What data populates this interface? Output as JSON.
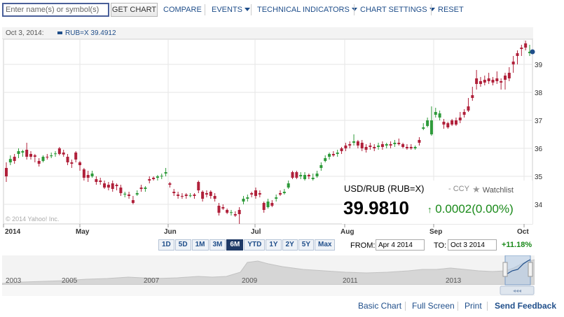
{
  "toolbar": {
    "symbol_placeholder": "Enter name(s) or symbol(s)",
    "get_chart": "GET CHART",
    "compare": "COMPARE",
    "events": "EVENTS",
    "technical_indicators": "TECHNICAL INDICATORS",
    "chart_settings": "CHART SETTINGS",
    "reset": "RESET"
  },
  "info_bar": {
    "date": "Oct 3, 2014:",
    "legend": "RUB=X 39.4912",
    "swatch_color": "#1f4e8a"
  },
  "quote": {
    "title": "USD/RUB (RUB=X)",
    "ccy": "- CCY",
    "watchlist": "Watchlist",
    "price": "39.9810",
    "change": "0.0002(0.00%)"
  },
  "watermark": "© 2014 Yahoo! Inc.",
  "ranges": {
    "buttons": [
      "1D",
      "5D",
      "1M",
      "3M",
      "6M",
      "YTD",
      "1Y",
      "2Y",
      "5Y",
      "Max"
    ],
    "active": "6M",
    "from_label": "FROM:",
    "from_value": "Apr 4 2014",
    "to_label": "TO:",
    "to_value": "Oct 3 2014",
    "pct_change": "+11.18%"
  },
  "navigator": {
    "year_labels": [
      "2003",
      "2005",
      "2007",
      "2009",
      "2011",
      "2013"
    ]
  },
  "footer": {
    "basic_chart": "Basic Chart",
    "full_screen": "Full Screen",
    "print": "Print",
    "send_feedback": "Send Feedback"
  },
  "colors": {
    "up": "#2e9a3a",
    "down": "#b0203a",
    "accent": "#1f4e8a",
    "positive": "#1a8a1a"
  },
  "chart_data": {
    "type": "candlestick",
    "symbol": "RUB=X",
    "x_tick_labels": [
      "2014",
      "May",
      "Jun",
      "Jul",
      "Aug",
      "Sep",
      "Oct"
    ],
    "y_tick_labels": [
      "34",
      "35",
      "36",
      "37",
      "38",
      "39"
    ],
    "ylim": [
      33.3,
      39.9
    ],
    "grid": true,
    "candles": [
      {
        "o": 35.3,
        "c": 35.0,
        "h": 35.5,
        "l": 34.8
      },
      {
        "o": 35.5,
        "c": 35.62,
        "h": 35.75,
        "l": 35.4
      },
      {
        "o": 35.7,
        "c": 35.55,
        "h": 35.8,
        "l": 35.45
      },
      {
        "o": 35.8,
        "c": 35.9,
        "h": 36.0,
        "l": 35.65
      },
      {
        "o": 35.85,
        "c": 35.9,
        "h": 35.95,
        "l": 35.7
      },
      {
        "o": 35.95,
        "c": 35.7,
        "h": 36.2,
        "l": 35.6
      },
      {
        "o": 35.8,
        "c": 35.7,
        "h": 35.9,
        "l": 35.6
      },
      {
        "o": 35.75,
        "c": 35.7,
        "h": 35.8,
        "l": 35.5
      },
      {
        "o": 35.55,
        "c": 35.45,
        "h": 35.65,
        "l": 35.35
      },
      {
        "o": 35.55,
        "c": 35.7,
        "h": 35.75,
        "l": 35.5
      },
      {
        "o": 35.7,
        "c": 35.68,
        "h": 35.8,
        "l": 35.6
      },
      {
        "o": 35.72,
        "c": 35.75,
        "h": 35.85,
        "l": 35.65
      },
      {
        "o": 35.8,
        "c": 35.82,
        "h": 35.9,
        "l": 35.7
      },
      {
        "o": 36.0,
        "c": 35.8,
        "h": 36.05,
        "l": 35.75
      },
      {
        "o": 35.85,
        "c": 35.78,
        "h": 35.95,
        "l": 35.7
      },
      {
        "o": 35.7,
        "c": 35.5,
        "h": 35.8,
        "l": 35.4
      },
      {
        "o": 35.5,
        "c": 35.45,
        "h": 35.6,
        "l": 35.3
      },
      {
        "o": 35.85,
        "c": 35.6,
        "h": 35.9,
        "l": 35.5
      },
      {
        "o": 35.5,
        "c": 35.4,
        "h": 35.55,
        "l": 35.2
      },
      {
        "o": 35.25,
        "c": 34.95,
        "h": 35.3,
        "l": 34.85
      },
      {
        "o": 35.05,
        "c": 34.95,
        "h": 35.2,
        "l": 34.8
      },
      {
        "o": 35.0,
        "c": 35.1,
        "h": 35.2,
        "l": 34.95
      },
      {
        "o": 34.9,
        "c": 34.8,
        "h": 35.0,
        "l": 34.7
      },
      {
        "o": 34.85,
        "c": 34.8,
        "h": 34.95,
        "l": 34.7
      },
      {
        "o": 34.75,
        "c": 34.6,
        "h": 34.85,
        "l": 34.55
      },
      {
        "o": 34.7,
        "c": 34.6,
        "h": 34.8,
        "l": 34.5
      },
      {
        "o": 34.75,
        "c": 34.55,
        "h": 34.85,
        "l": 34.45
      },
      {
        "o": 34.7,
        "c": 34.65,
        "h": 34.75,
        "l": 34.5
      },
      {
        "o": 34.6,
        "c": 34.4,
        "h": 34.7,
        "l": 34.3
      },
      {
        "o": 34.35,
        "c": 34.38,
        "h": 34.45,
        "l": 34.25
      },
      {
        "o": 34.35,
        "c": 34.3,
        "h": 34.45,
        "l": 34.2
      },
      {
        "o": 34.15,
        "c": 34.05,
        "h": 34.3,
        "l": 34.0
      },
      {
        "o": 34.35,
        "c": 34.4,
        "h": 34.5,
        "l": 34.3
      },
      {
        "o": 34.6,
        "c": 34.55,
        "h": 34.7,
        "l": 34.45
      },
      {
        "o": 34.55,
        "c": 34.6,
        "h": 34.65,
        "l": 34.45
      },
      {
        "o": 34.9,
        "c": 34.85,
        "h": 35.0,
        "l": 34.75
      },
      {
        "o": 34.95,
        "c": 34.9,
        "h": 35.0,
        "l": 34.85
      },
      {
        "o": 34.95,
        "c": 35.0,
        "h": 35.05,
        "l": 34.85
      },
      {
        "o": 35.0,
        "c": 35.02,
        "h": 35.1,
        "l": 34.9
      },
      {
        "o": 35.1,
        "c": 35.15,
        "h": 35.3,
        "l": 35.0
      },
      {
        "o": 34.75,
        "c": 34.7,
        "h": 34.8,
        "l": 34.6
      },
      {
        "o": 34.45,
        "c": 34.4,
        "h": 34.55,
        "l": 34.3
      },
      {
        "o": 34.35,
        "c": 34.3,
        "h": 34.45,
        "l": 34.2
      },
      {
        "o": 34.3,
        "c": 34.28,
        "h": 34.4,
        "l": 34.2
      },
      {
        "o": 34.35,
        "c": 34.3,
        "h": 34.4,
        "l": 34.2
      },
      {
        "o": 34.3,
        "c": 34.32,
        "h": 34.4,
        "l": 34.25
      },
      {
        "o": 34.35,
        "c": 34.3,
        "h": 34.4,
        "l": 34.2
      },
      {
        "o": 34.8,
        "c": 34.5,
        "h": 34.85,
        "l": 34.4
      },
      {
        "o": 34.45,
        "c": 34.2,
        "h": 34.5,
        "l": 34.1
      },
      {
        "o": 34.4,
        "c": 34.35,
        "h": 34.5,
        "l": 34.25
      },
      {
        "o": 34.45,
        "c": 34.3,
        "h": 34.5,
        "l": 34.2
      },
      {
        "o": 34.3,
        "c": 34.2,
        "h": 34.4,
        "l": 34.1
      },
      {
        "o": 33.95,
        "c": 33.7,
        "h": 34.05,
        "l": 33.6
      },
      {
        "o": 33.9,
        "c": 33.85,
        "h": 34.0,
        "l": 33.8
      },
      {
        "o": 33.8,
        "c": 33.7,
        "h": 33.85,
        "l": 33.65
      },
      {
        "o": 33.7,
        "c": 33.72,
        "h": 33.8,
        "l": 33.6
      },
      {
        "o": 33.65,
        "c": 33.6,
        "h": 33.75,
        "l": 33.55
      },
      {
        "o": 33.8,
        "c": 33.65,
        "h": 33.9,
        "l": 33.3
      },
      {
        "o": 34.1,
        "c": 34.2,
        "h": 34.3,
        "l": 34.0
      },
      {
        "o": 34.2,
        "c": 34.25,
        "h": 34.35,
        "l": 34.1
      },
      {
        "o": 34.4,
        "c": 34.35,
        "h": 34.45,
        "l": 34.25
      },
      {
        "o": 34.5,
        "c": 34.3,
        "h": 34.6,
        "l": 34.2
      },
      {
        "o": 34.4,
        "c": 34.35,
        "h": 34.5,
        "l": 34.25
      },
      {
        "o": 34.05,
        "c": 33.8,
        "h": 34.1,
        "l": 33.7
      },
      {
        "o": 33.9,
        "c": 34.1,
        "h": 34.2,
        "l": 33.85
      },
      {
        "o": 34.05,
        "c": 33.95,
        "h": 34.15,
        "l": 33.9
      },
      {
        "o": 34.2,
        "c": 34.25,
        "h": 34.35,
        "l": 34.1
      },
      {
        "o": 34.4,
        "c": 34.35,
        "h": 34.5,
        "l": 34.3
      },
      {
        "o": 34.4,
        "c": 34.45,
        "h": 34.55,
        "l": 34.35
      },
      {
        "o": 34.6,
        "c": 34.75,
        "h": 34.85,
        "l": 34.55
      },
      {
        "o": 35.15,
        "c": 34.95,
        "h": 35.2,
        "l": 34.9
      },
      {
        "o": 35.15,
        "c": 34.95,
        "h": 35.2,
        "l": 34.9
      },
      {
        "o": 35.0,
        "c": 35.05,
        "h": 35.15,
        "l": 34.9
      },
      {
        "o": 34.9,
        "c": 35.05,
        "h": 35.15,
        "l": 34.85
      },
      {
        "o": 35.05,
        "c": 35.0,
        "h": 35.1,
        "l": 34.9
      },
      {
        "o": 34.9,
        "c": 34.95,
        "h": 35.1,
        "l": 34.85
      },
      {
        "o": 35.0,
        "c": 35.1,
        "h": 35.2,
        "l": 34.95
      },
      {
        "o": 35.3,
        "c": 35.4,
        "h": 35.5,
        "l": 35.2
      },
      {
        "o": 35.55,
        "c": 35.65,
        "h": 35.75,
        "l": 35.5
      },
      {
        "o": 35.7,
        "c": 35.8,
        "h": 35.85,
        "l": 35.6
      },
      {
        "o": 35.8,
        "c": 35.75,
        "h": 35.9,
        "l": 35.7
      },
      {
        "o": 35.8,
        "c": 35.85,
        "h": 35.95,
        "l": 35.7
      },
      {
        "o": 36.0,
        "c": 35.9,
        "h": 36.05,
        "l": 35.8
      },
      {
        "o": 36.1,
        "c": 36.0,
        "h": 36.2,
        "l": 35.9
      },
      {
        "o": 36.15,
        "c": 36.1,
        "h": 36.25,
        "l": 36.0
      },
      {
        "o": 36.2,
        "c": 36.25,
        "h": 36.5,
        "l": 36.1
      },
      {
        "o": 36.25,
        "c": 36.1,
        "h": 36.3,
        "l": 36.0
      },
      {
        "o": 36.2,
        "c": 36.0,
        "h": 36.3,
        "l": 35.9
      },
      {
        "o": 36.05,
        "c": 35.95,
        "h": 36.15,
        "l": 35.85
      },
      {
        "o": 36.1,
        "c": 36.05,
        "h": 36.2,
        "l": 35.95
      },
      {
        "o": 36.05,
        "c": 36.0,
        "h": 36.15,
        "l": 35.9
      },
      {
        "o": 36.05,
        "c": 36.1,
        "h": 36.2,
        "l": 35.95
      },
      {
        "o": 36.15,
        "c": 36.05,
        "h": 36.25,
        "l": 35.95
      },
      {
        "o": 36.1,
        "c": 36.15,
        "h": 36.2,
        "l": 36.0
      },
      {
        "o": 36.15,
        "c": 36.1,
        "h": 36.25,
        "l": 36.0
      },
      {
        "o": 36.15,
        "c": 36.2,
        "h": 36.3,
        "l": 36.05
      },
      {
        "o": 36.2,
        "c": 36.15,
        "h": 36.35,
        "l": 36.1
      },
      {
        "o": 36.15,
        "c": 36.05,
        "h": 36.2,
        "l": 36.0
      },
      {
        "o": 36.05,
        "c": 36.0,
        "h": 36.15,
        "l": 35.95
      },
      {
        "o": 36.05,
        "c": 36.0,
        "h": 36.15,
        "l": 35.95
      },
      {
        "o": 36.0,
        "c": 36.05,
        "h": 36.1,
        "l": 35.95
      },
      {
        "o": 36.3,
        "c": 36.2,
        "h": 36.4,
        "l": 36.1
      },
      {
        "o": 36.7,
        "c": 36.75,
        "h": 36.9,
        "l": 36.65
      },
      {
        "o": 36.8,
        "c": 37.0,
        "h": 37.1,
        "l": 36.75
      },
      {
        "o": 36.5,
        "c": 37.0,
        "h": 37.5,
        "l": 36.45
      },
      {
        "o": 37.2,
        "c": 37.3,
        "h": 37.45,
        "l": 37.1
      },
      {
        "o": 37.1,
        "c": 37.25,
        "h": 37.35,
        "l": 37.0
      },
      {
        "o": 36.95,
        "c": 36.85,
        "h": 37.05,
        "l": 36.7
      },
      {
        "o": 36.9,
        "c": 36.75,
        "h": 36.95,
        "l": 36.7
      },
      {
        "o": 37.0,
        "c": 36.85,
        "h": 37.05,
        "l": 36.8
      },
      {
        "o": 37.0,
        "c": 36.85,
        "h": 37.1,
        "l": 36.8
      },
      {
        "o": 37.1,
        "c": 37.0,
        "h": 37.3,
        "l": 36.9
      },
      {
        "o": 37.3,
        "c": 37.2,
        "h": 37.4,
        "l": 37.1
      },
      {
        "o": 37.5,
        "c": 37.35,
        "h": 37.8,
        "l": 37.3
      },
      {
        "o": 37.9,
        "c": 37.8,
        "h": 38.2,
        "l": 37.7
      },
      {
        "o": 38.5,
        "c": 38.3,
        "h": 38.8,
        "l": 38.1
      },
      {
        "o": 38.4,
        "c": 38.3,
        "h": 38.55,
        "l": 38.2
      },
      {
        "o": 38.45,
        "c": 38.35,
        "h": 38.6,
        "l": 38.25
      },
      {
        "o": 38.5,
        "c": 38.4,
        "h": 38.7,
        "l": 38.3
      },
      {
        "o": 38.45,
        "c": 38.35,
        "h": 38.55,
        "l": 38.25
      },
      {
        "o": 38.5,
        "c": 38.4,
        "h": 38.75,
        "l": 38.3
      },
      {
        "o": 38.4,
        "c": 38.35,
        "h": 38.5,
        "l": 38.1
      },
      {
        "o": 38.6,
        "c": 38.45,
        "h": 38.7,
        "l": 38.1
      },
      {
        "o": 38.7,
        "c": 38.5,
        "h": 38.9,
        "l": 38.4
      },
      {
        "o": 39.1,
        "c": 39.0,
        "h": 39.3,
        "l": 38.7
      },
      {
        "o": 39.4,
        "c": 39.3,
        "h": 39.5,
        "l": 39.0
      },
      {
        "o": 39.6,
        "c": 39.55,
        "h": 39.7,
        "l": 39.3
      },
      {
        "o": 39.75,
        "c": 39.6,
        "h": 39.85,
        "l": 39.5
      },
      {
        "o": 39.4,
        "c": 39.45,
        "h": 39.7,
        "l": 39.3
      }
    ]
  }
}
